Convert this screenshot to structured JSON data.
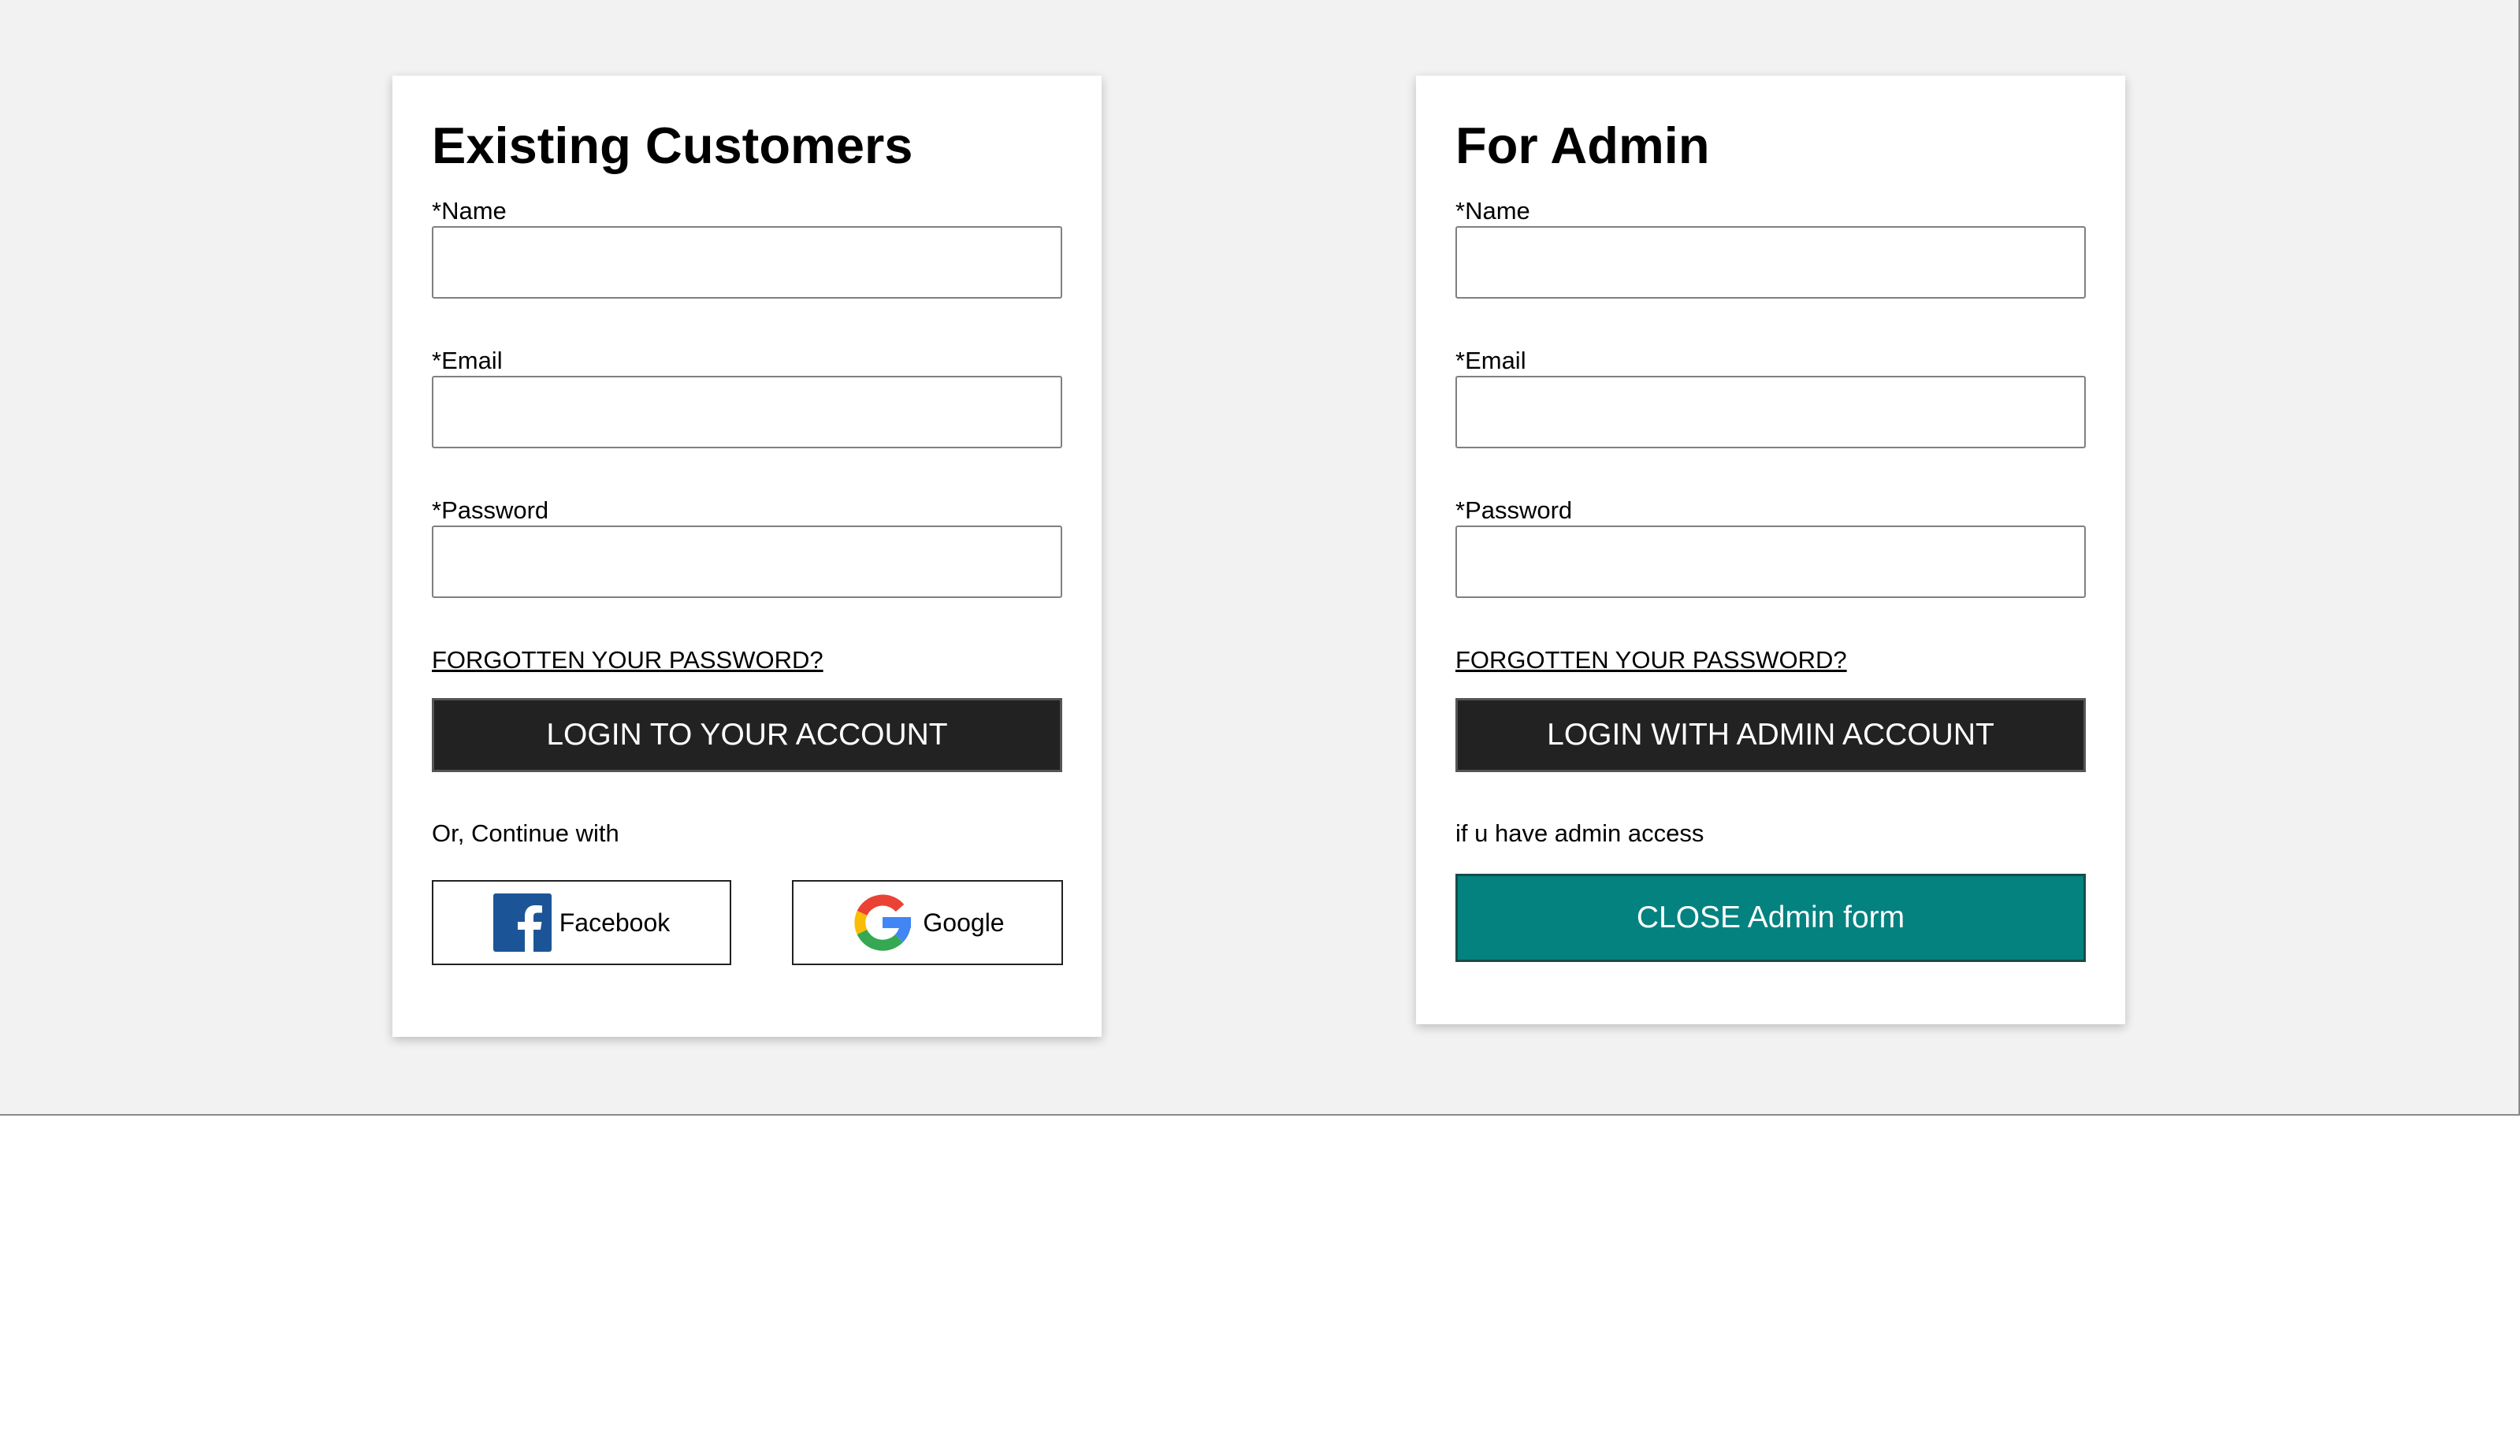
{
  "customer_form": {
    "title": "Existing Customers",
    "name_label": "*Name",
    "name_value": "",
    "email_label": "*Email",
    "email_value": "",
    "password_label": "*Password",
    "password_value": "",
    "forgot_link": "FORGOTTEN YOUR PASSWORD?",
    "login_button": "LOGIN TO YOUR ACCOUNT",
    "continue_text": "Or, Continue with",
    "facebook_label": "Facebook",
    "google_label": "Google"
  },
  "admin_form": {
    "title": "For Admin",
    "name_label": "*Name",
    "name_value": "",
    "email_label": "*Email",
    "email_value": "",
    "password_label": "*Password",
    "password_value": "",
    "forgot_link": "FORGOTTEN YOUR PASSWORD?",
    "login_button": "LOGIN WITH ADMIN ACCOUNT",
    "access_text": "if u have admin access",
    "close_button": "CLOSE Admin form"
  },
  "icons": {
    "facebook": "facebook-icon",
    "google": "google-icon"
  },
  "colors": {
    "page_background": "#f2f2f2",
    "dark_button": "#222222",
    "teal_button": "#038280",
    "facebook_blue": "#1b5597"
  }
}
